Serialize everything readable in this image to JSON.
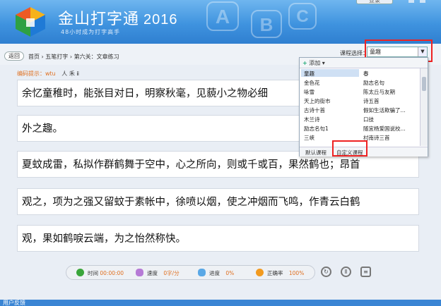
{
  "app": {
    "title": "金山打字通",
    "year": "2016",
    "subtitle": "48小时成为打字高手",
    "top_button": "登录"
  },
  "nav": {
    "back": "返回",
    "breadcrumb": "首页 › 五笔打字 › 第六关：文章练习",
    "course_label": "课程选择：",
    "course_value": "童趣"
  },
  "hint": {
    "label": "编码提示：wtu",
    "value": "人 禾 ⅱ"
  },
  "lines": [
    "余忆童稚时，能张目对日，明察秋毫，见藐小之物必细",
    "外之趣。",
    "夏蚊成雷，私拟作群鹤舞于空中，心之所向，则或千或百，果然鹤也；昂首",
    "观之，项为之强又留蚊于素帐中，徐喷以烟，使之冲烟而飞鸣，作青云白鹤",
    "观，果如鹤唳云端，为之怡然称快。"
  ],
  "dropdown": {
    "add": "添加",
    "left_items": [
      "童趣",
      "金色花",
      "咏雪",
      "天上的街市",
      "古诗十首",
      "木兰诗",
      "励志名句1",
      "三峡"
    ],
    "right_items": [
      "春",
      "励志名句",
      "陈太丘与友期",
      "诗五首",
      "假如生活欺骗了...",
      "口技",
      "随宜杨爱国说校...",
      "村南诗三首"
    ],
    "tabs": [
      "默认课程",
      "自定义课程"
    ]
  },
  "status": {
    "time_label": "时间",
    "time_value": "00:00:00",
    "speed_label": "速度",
    "speed_value": "0字/分",
    "progress_label": "进度",
    "progress_value": "0%",
    "accuracy_label": "正确率",
    "accuracy_value": "100%"
  },
  "bottom": {
    "text": "用户反馈"
  },
  "colors": {
    "header": "#3f93df",
    "accent": "#e07020",
    "highlight_box": "#e22222"
  }
}
